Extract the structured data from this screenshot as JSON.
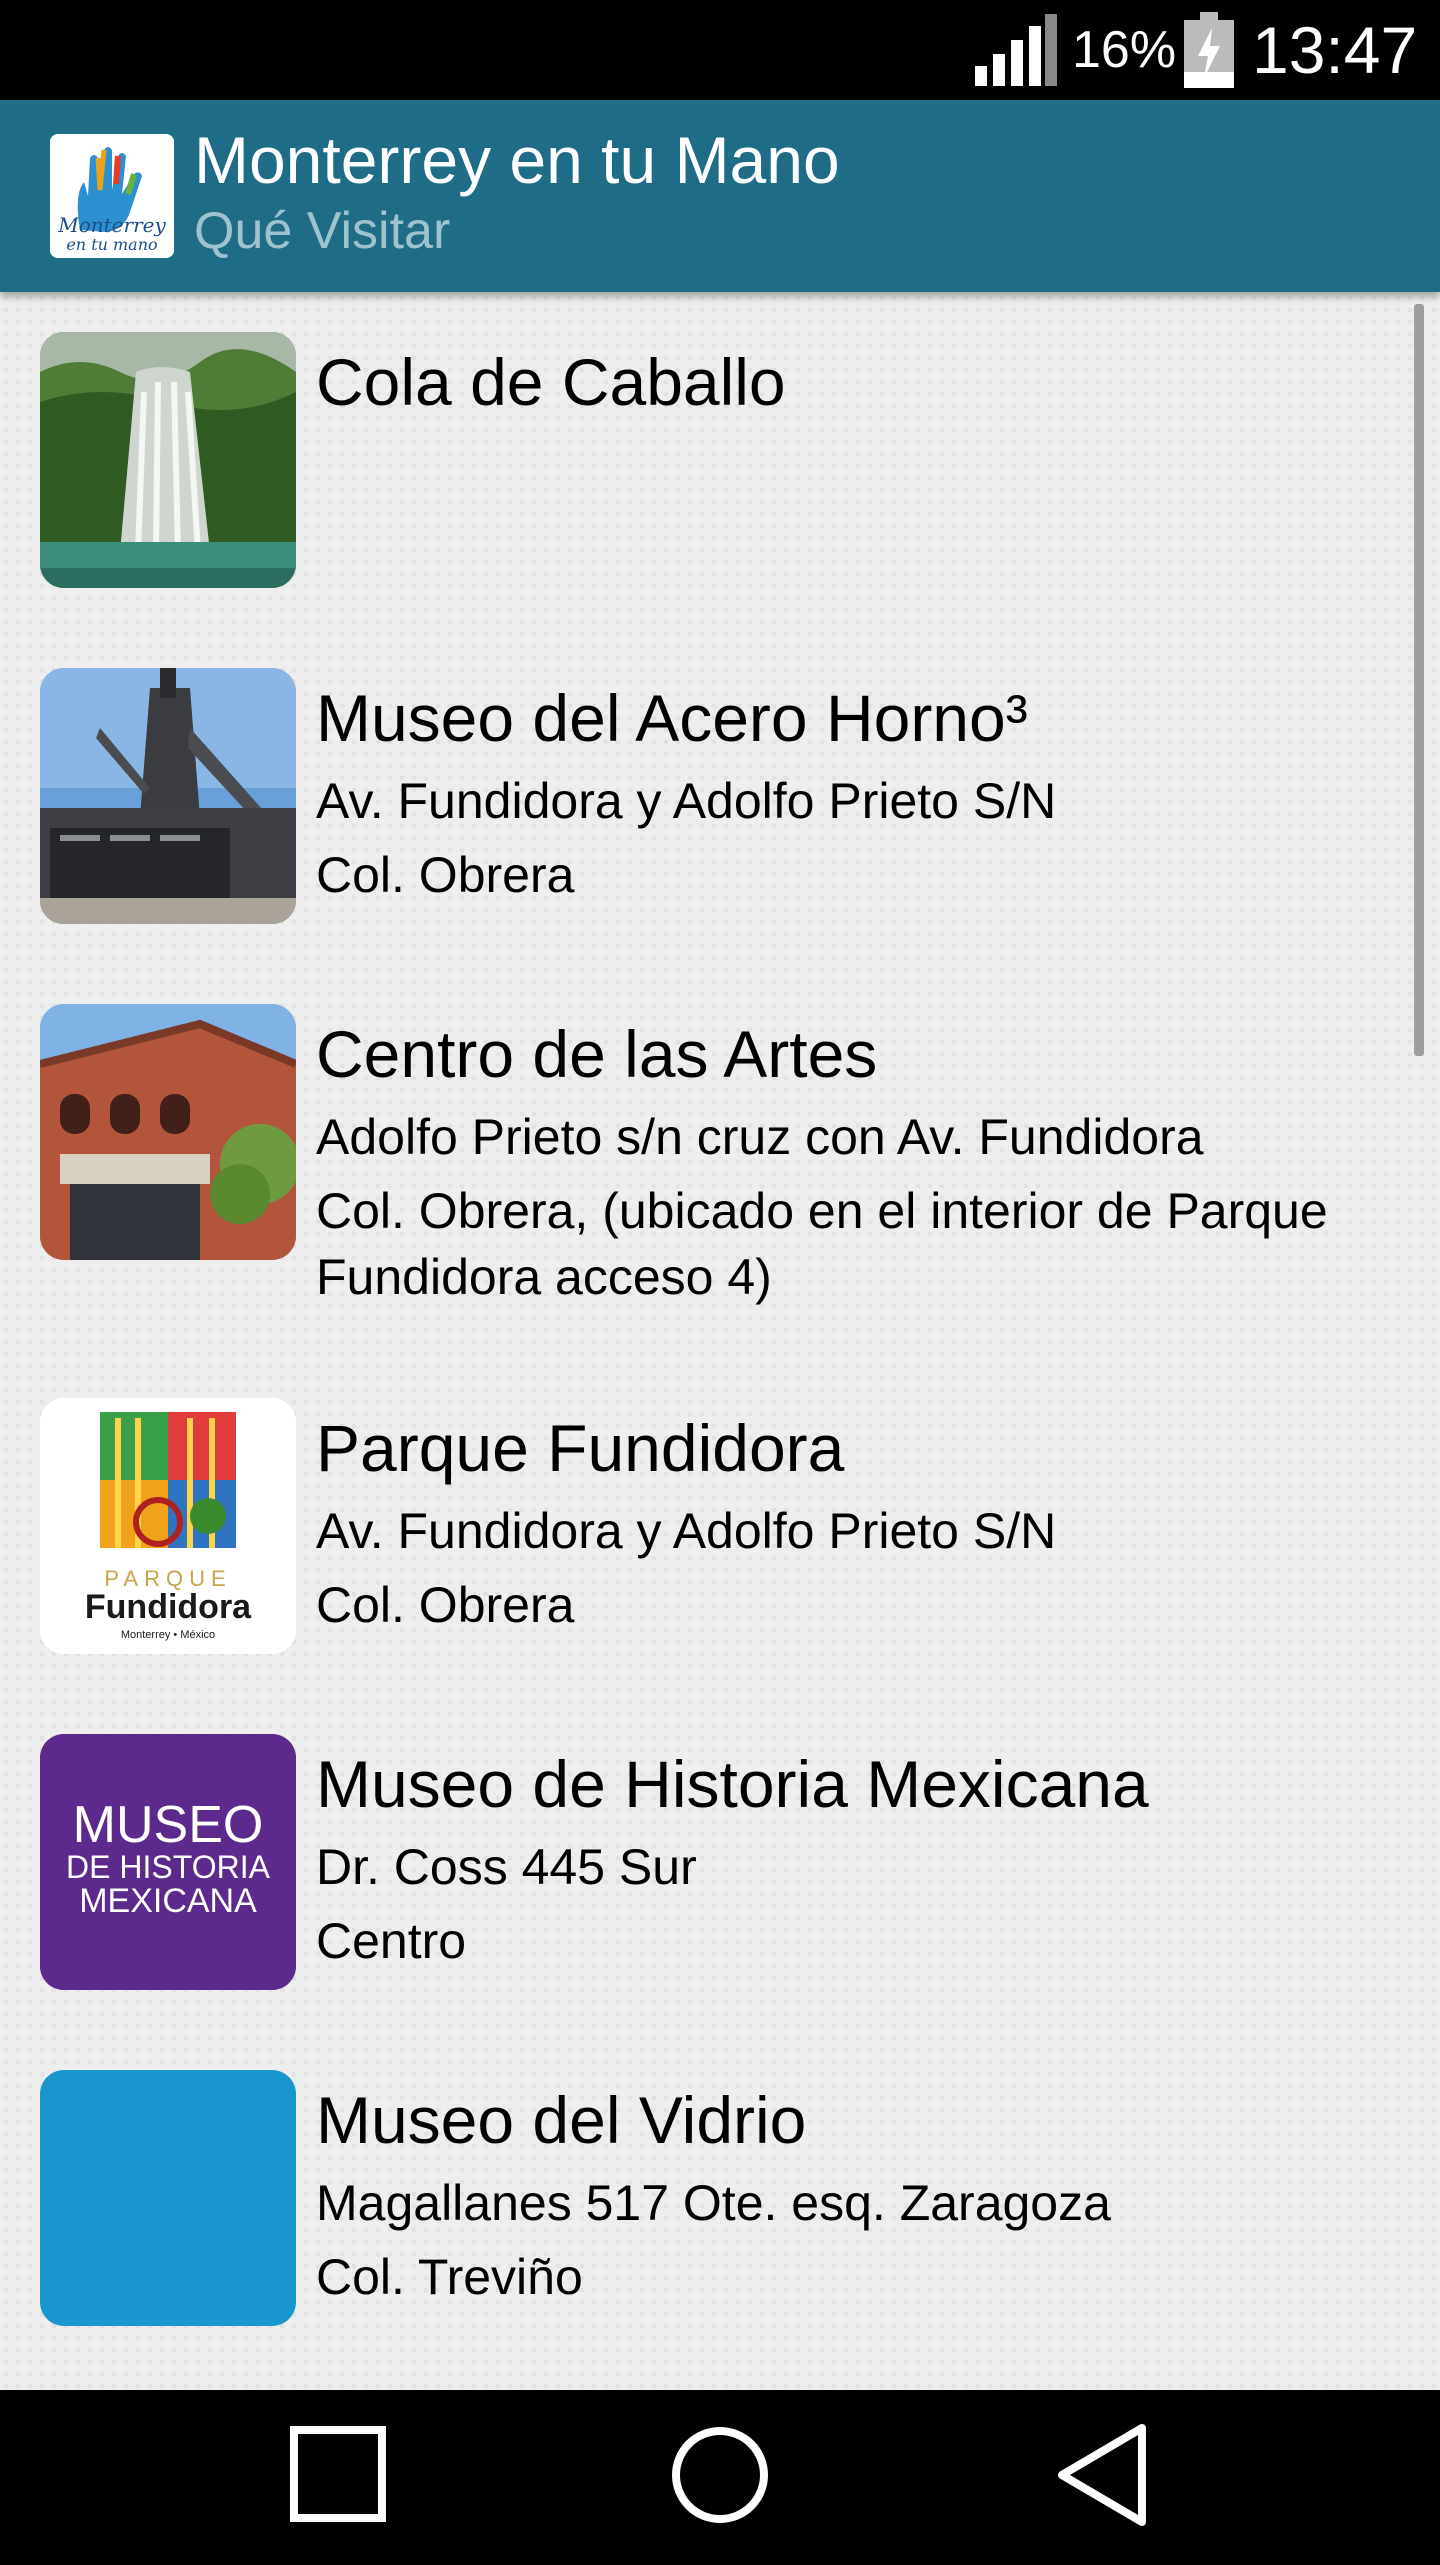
{
  "status_bar": {
    "battery_percent": "16%",
    "time": "13:47",
    "icons": [
      "signal-icon",
      "battery-charging-icon"
    ]
  },
  "app_bar": {
    "title": "Monterrey en tu Mano",
    "subtitle": "Qué Visitar",
    "logo_text_1": "Monterrey",
    "logo_text_2": "en tu mano"
  },
  "places": [
    {
      "title": "Cola de Caballo",
      "lines": [],
      "thumb": "waterfall-photo"
    },
    {
      "title": "Museo del Acero Horno³",
      "lines": [
        "Av. Fundidora y Adolfo Prieto S/N",
        "Col. Obrera"
      ],
      "thumb": "blast-furnace-photo"
    },
    {
      "title": "Centro de las Artes",
      "lines": [
        "Adolfo Prieto s/n cruz con Av. Fundidora",
        "Col. Obrera, (ubicado en el interior de Parque Fundidora acceso 4)"
      ],
      "thumb": "brick-building-photo"
    },
    {
      "title": "Parque Fundidora",
      "lines": [
        "Av. Fundidora y Adolfo Prieto S/N",
        "Col. Obrera"
      ],
      "thumb": "parque-fundidora-logo",
      "logo_text": {
        "line1": "PARQUE",
        "line2": "Fundidora",
        "line3": "Monterrey • México"
      }
    },
    {
      "title": "Museo de Historia Mexicana",
      "lines": [
        "Dr. Coss 445 Sur",
        "Centro"
      ],
      "thumb": "museo-historia-logo",
      "logo_text": {
        "line1": "MUSEO",
        "line2": "DE HISTORIA",
        "line3": "MEXICANA"
      }
    },
    {
      "title": "Museo del Vidrio",
      "lines": [
        "Magallanes 517 Ote. esq. Zaragoza",
        "Col. Treviño"
      ],
      "thumb": "museo-vidrio-logo"
    }
  ],
  "colors": {
    "app_bar": "#1e6c86",
    "subtitle": "#9fc2cf",
    "content_bg": "#eeeeee",
    "museo_historia_purple": "#5b2a8c",
    "museo_vidrio_blue": "#1a96cf"
  },
  "nav_bar": {
    "buttons": [
      "recents-square-icon",
      "home-circle-icon",
      "back-triangle-icon"
    ]
  }
}
